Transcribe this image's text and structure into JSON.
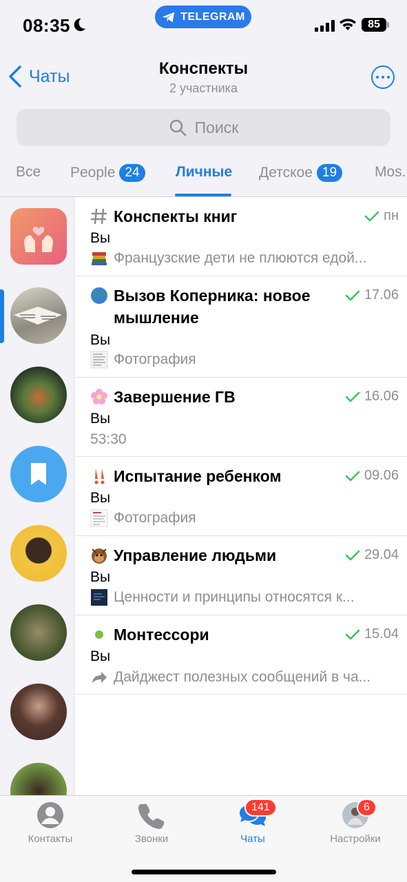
{
  "status_bar": {
    "time": "08:35",
    "pill_label": "TELEGRAM",
    "battery": "85"
  },
  "header": {
    "back_label": "Чаты",
    "title": "Конспекты",
    "subtitle": "2 участника"
  },
  "search": {
    "placeholder": "Поиск"
  },
  "filters": [
    {
      "label": "Все",
      "badge": null
    },
    {
      "label": "People",
      "badge": "24"
    },
    {
      "label": "Личные",
      "badge": null,
      "active": true
    },
    {
      "label": "Детское",
      "badge": "19"
    },
    {
      "label": "Mos.",
      "badge": null
    }
  ],
  "chats": [
    {
      "title": "Конспекты книг",
      "icon": "hashtag-icon",
      "time": "пн",
      "sender": "Вы",
      "preview": "Французские дети не плюются едой...",
      "preview_icon": "books-thumbnail"
    },
    {
      "title": "Вызов Коперника: новое мышление",
      "icon": "globe-emoji",
      "time": "17.06",
      "sender": "Вы",
      "preview": "Фотография",
      "preview_icon": "photo-thumbnail"
    },
    {
      "title": "Завершение ГВ",
      "icon": "flower-emoji",
      "time": "16.06",
      "sender": "Вы",
      "preview": "53:30",
      "preview_icon": null
    },
    {
      "title": "Испытание ребенком",
      "icon": "exclamation-emoji",
      "time": "09.06",
      "sender": "Вы",
      "preview": "Фотография",
      "preview_icon": "photo-thumbnail"
    },
    {
      "title": "Управление людьми",
      "icon": "monkey-emoji",
      "time": "29.04",
      "sender": "Вы",
      "preview": "Ценности и принципы относятся к...",
      "preview_icon": "dark-thumbnail"
    },
    {
      "title": "Монтессори",
      "icon": "green-dot-emoji",
      "time": "15.04",
      "sender": "Вы",
      "preview": "Дайджест полезных сообщений в ча...",
      "preview_icon": "forward-arrow-icon"
    }
  ],
  "tabbar": {
    "contacts": "Контакты",
    "calls": "Звонки",
    "chats": "Чаты",
    "chats_badge": "141",
    "settings": "Настройки",
    "settings_badge": "6"
  },
  "colors": {
    "accent": "#1e7fe6",
    "badge_red": "#ff3b30",
    "check_green": "#34c759"
  }
}
